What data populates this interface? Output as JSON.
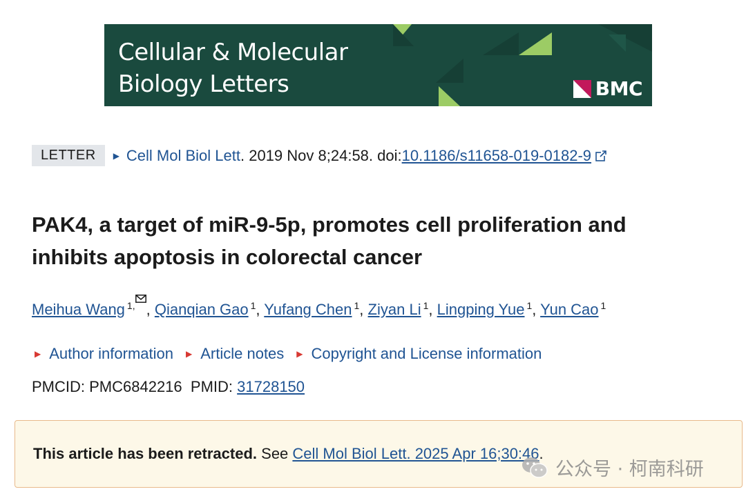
{
  "banner": {
    "title_line1": "Cellular & Molecular",
    "title_line2": "Biology Letters",
    "publisher": "BMC",
    "bg_color": "#1a4a3e",
    "accent_color": "#9ccc65"
  },
  "citation": {
    "badge": "LETTER",
    "journal": "Cell Mol Biol Lett",
    "details": ". 2019 Nov 8;24:58. doi: ",
    "doi": "10.1186/s11658-019-0182-9",
    "external_icon": "external-link-icon"
  },
  "title": "PAK4, a target of miR-9-5p, promotes cell proliferation and inhibits apoptosis in colorectal cancer",
  "authors": [
    {
      "name": "Meihua Wang",
      "sup": "1,"
    },
    {
      "name": "Qianqian Gao",
      "sup": "1"
    },
    {
      "name": "Yufang Chen",
      "sup": "1"
    },
    {
      "name": "Ziyan Li",
      "sup": "1"
    },
    {
      "name": "Lingping Yue",
      "sup": "1"
    },
    {
      "name": "Yun Cao",
      "sup": "1"
    }
  ],
  "separator": ",",
  "info_links": [
    "Author information",
    "Article notes",
    "Copyright and License information"
  ],
  "ids": {
    "pmcid_label": "PMCID: PMC6842216",
    "pmid_label": "PMID:",
    "pmid": "31728150"
  },
  "notice": {
    "bold": "This article has been retracted.",
    "see": " See ",
    "link": "Cell Mol Biol Lett. 2025 Apr 16;30:46",
    "end": "."
  },
  "watermark": {
    "text": "公众号 · 柯南科研",
    "icon": "wechat-icon"
  },
  "colors": {
    "link": "#205493",
    "red_marker": "#d83933",
    "notice_bg": "#fdf8e8",
    "notice_border": "#e8b98a"
  }
}
